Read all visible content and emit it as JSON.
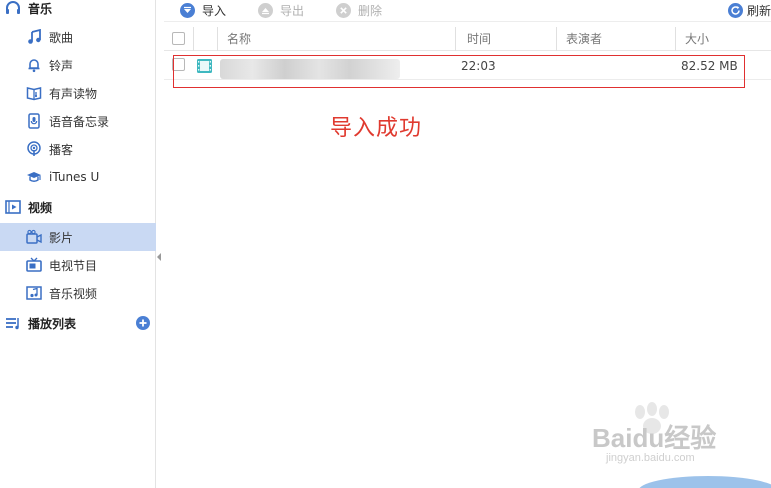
{
  "sidebar": {
    "music": {
      "label": "音乐",
      "icon": "headphones-icon"
    },
    "items_music": [
      {
        "label": "歌曲",
        "icon": "music-note-icon"
      },
      {
        "label": "铃声",
        "icon": "bell-icon"
      },
      {
        "label": "有声读物",
        "icon": "audiobook-icon"
      },
      {
        "label": "语音备忘录",
        "icon": "voice-memo-icon"
      },
      {
        "label": "播客",
        "icon": "podcast-icon"
      },
      {
        "label": "iTunes U",
        "icon": "graduation-cap-icon"
      }
    ],
    "video": {
      "label": "视频",
      "icon": "film-icon"
    },
    "items_video": [
      {
        "label": "影片",
        "icon": "movie-camera-icon",
        "active": true
      },
      {
        "label": "电视节目",
        "icon": "tv-icon"
      },
      {
        "label": "音乐视频",
        "icon": "music-video-icon"
      }
    ],
    "playlist": {
      "label": "播放列表",
      "icon": "playlist-icon",
      "add_icon": "add-circle-icon"
    }
  },
  "toolbar": {
    "import_label": "导入",
    "export_label": "导出",
    "delete_label": "删除",
    "refresh_label": "刷新"
  },
  "table": {
    "columns": {
      "name": "名称",
      "time": "时间",
      "performer": "表演者",
      "size": "大小"
    },
    "rows": [
      {
        "name": "",
        "time": "22:03",
        "performer": "",
        "size": "82.52 MB"
      }
    ]
  },
  "annotation": {
    "text": "导入成功"
  },
  "watermark": {
    "logo": "Baidu经验",
    "url": "jingyan.baidu.com"
  },
  "colors": {
    "accent": "#4a7fd4",
    "active_bg": "#c9d9f3",
    "annotation_red": "#e03a2f"
  }
}
